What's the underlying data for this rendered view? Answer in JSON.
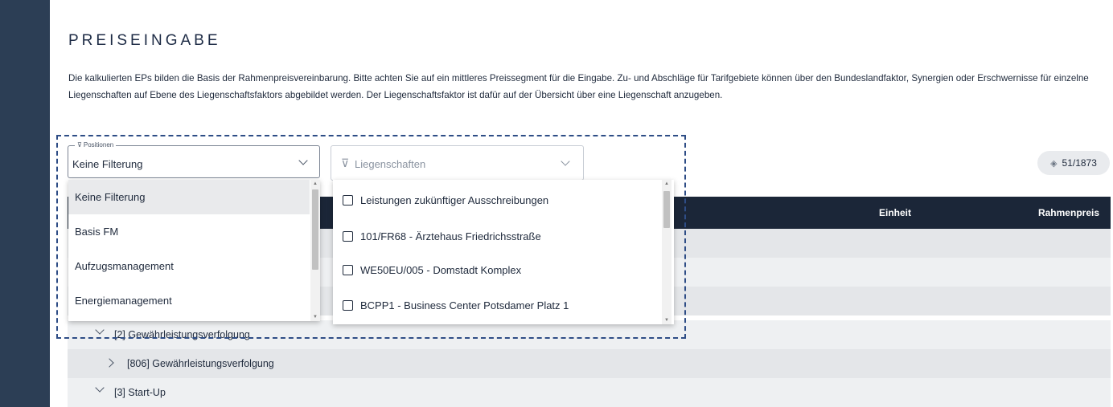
{
  "header": {
    "title": "PREISEINGABE",
    "intro": "Die kalkulierten EPs bilden die Basis der Rahmenpreisvereinbarung. Bitte achten Sie auf ein mittleres Preissegment für die Eingabe. Zu- und Abschläge für Tarifgebiete können über den Bundeslandfaktor, Synergien oder Erschwernisse für einzelne Liegenschaften auf Ebene des Liegenschaftsfaktors abgebildet werden. Der Liegenschaftsfaktor ist dafür auf der Übersicht über eine Liegenschaft anzugeben."
  },
  "filters": {
    "positionen": {
      "label": "Positionen",
      "value": "Keine Filterung",
      "options": [
        "Keine Filterung",
        "Basis FM",
        "Aufzugsmanagement",
        "Energiemanagement"
      ]
    },
    "liegenschaften": {
      "placeholder": "Liegenschaften",
      "options": [
        "Leistungen zukünftiger Ausschreibungen",
        "101/FR68 - Ärztehaus Friedrichsstraße",
        "WE50EU/005 - Domstadt Komplex",
        "BCPP1 - Business Center Potsdamer Platz 1"
      ]
    }
  },
  "count_badge": "51/1873",
  "table": {
    "columns": {
      "einheit": "Einheit",
      "rahmenpreis": "Rahmenpreis"
    },
    "rows": [
      {
        "label": "[2] Gewährleistungsverfolgung"
      },
      {
        "label": "[806] Gewährleistungsverfolgung"
      },
      {
        "label": "[3] Start-Up"
      }
    ]
  },
  "icons": {
    "filter": "filter-icon",
    "chevron": "chevron-down-icon",
    "badge": "diamond-icon"
  }
}
